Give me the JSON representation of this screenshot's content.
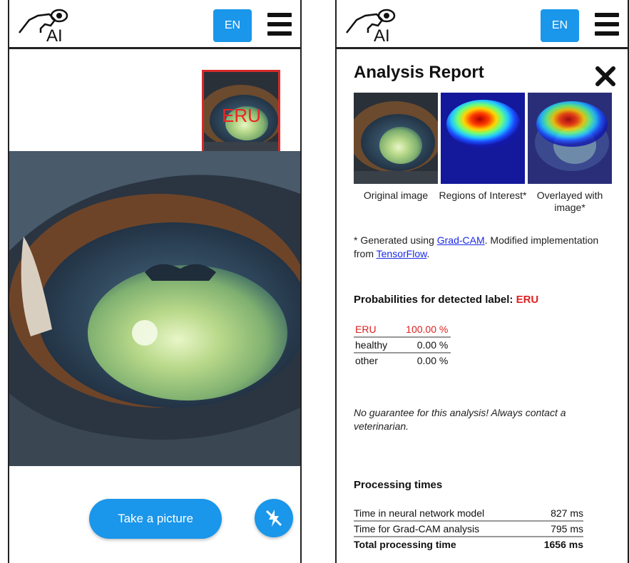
{
  "header": {
    "language_button": "EN",
    "logo_text": "AI"
  },
  "camera_view": {
    "thumbnail_label": "ERU",
    "take_picture_button": "Take a picture"
  },
  "report": {
    "title": "Analysis Report",
    "image_captions": [
      "Original image",
      "Regions of Interest*",
      "Overlayed with image*"
    ],
    "note": {
      "prefix": "* Generated using ",
      "gradcam_link": "Grad-CAM",
      "middle": ". Modified implementation from ",
      "tensorflow_link": "TensorFlow",
      "suffix": "."
    },
    "probabilities_title": "Probabilities for detected label: ",
    "detected_label": "ERU",
    "probabilities": [
      {
        "label": "ERU",
        "value": "100.00 %"
      },
      {
        "label": "healthy",
        "value": "0.00 %"
      },
      {
        "label": "other",
        "value": "0.00 %"
      }
    ],
    "warning": "No guarantee for this analysis! Always contact a veterinarian.",
    "processing_title": "Processing times",
    "processing_times": [
      {
        "label": "Time in neural network model",
        "value": "827 ms"
      },
      {
        "label": "Time for Grad-CAM analysis",
        "value": "795 ms"
      },
      {
        "label": "Total processing time",
        "value": "1656 ms"
      }
    ]
  },
  "colors": {
    "accent": "#1a96ea",
    "alert": "#e02020",
    "frame": "#d42a2a"
  }
}
